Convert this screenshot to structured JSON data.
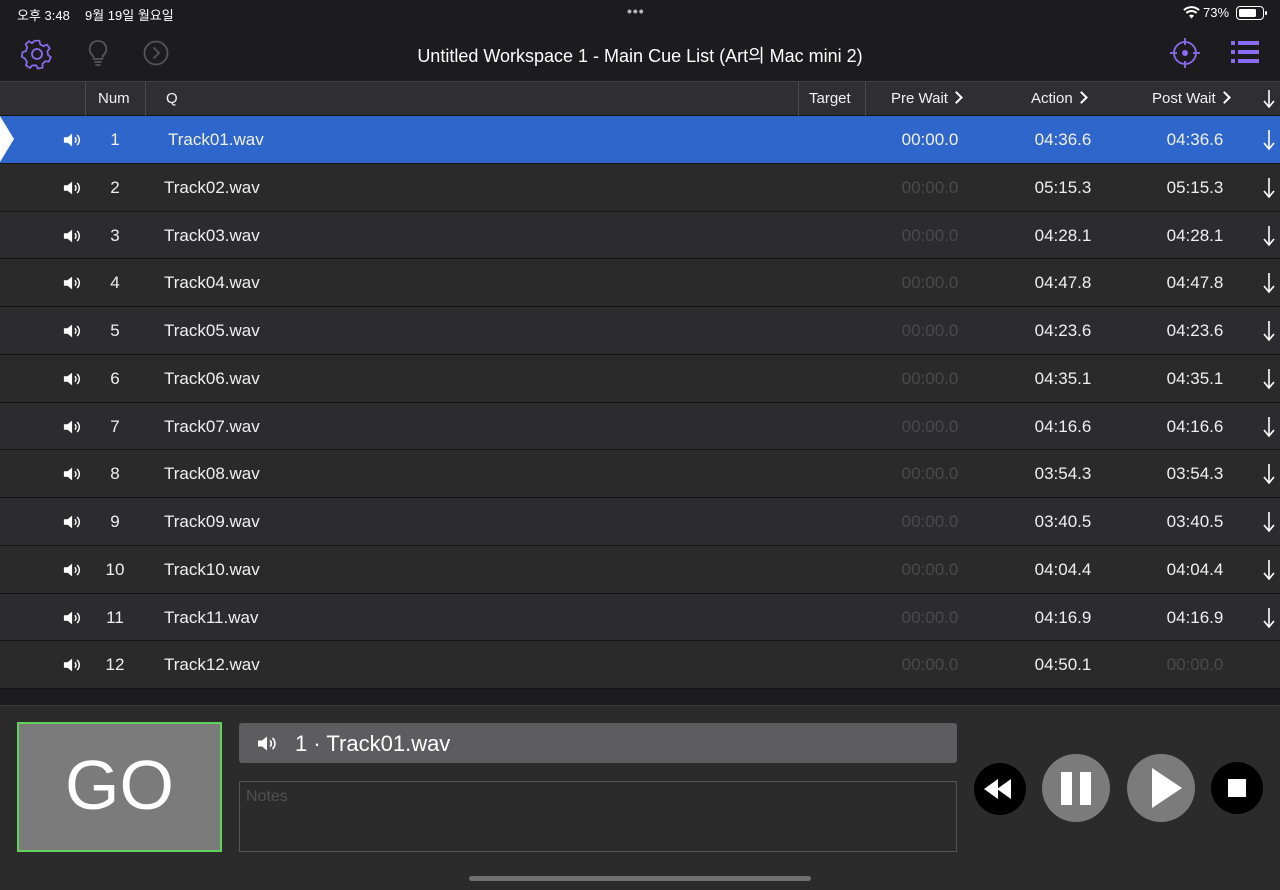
{
  "status": {
    "time": "오후 3:48",
    "date": "9월 19일 월요일",
    "dots": "•••",
    "battery_pct": "73%"
  },
  "toolbar": {
    "title": "Untitled Workspace 1 - Main Cue List (Art의 Mac mini 2)",
    "icons": [
      "gear-icon",
      "lightbulb-icon",
      "next-circle-icon",
      "target-icon",
      "list-icon"
    ],
    "accent_color": "#8b6cf0"
  },
  "columns": {
    "num": "Num",
    "q": "Q",
    "target": "Target",
    "pre_wait": "Pre Wait",
    "action": "Action",
    "post_wait": "Post Wait"
  },
  "cues": [
    {
      "num": "1",
      "name": "Track01.wav",
      "pre_wait": "00:00.0",
      "action": "04:36.6",
      "post_wait": "04:36.6"
    },
    {
      "num": "2",
      "name": "Track02.wav",
      "pre_wait": "00:00.0",
      "action": "05:15.3",
      "post_wait": "05:15.3"
    },
    {
      "num": "3",
      "name": "Track03.wav",
      "pre_wait": "00:00.0",
      "action": "04:28.1",
      "post_wait": "04:28.1"
    },
    {
      "num": "4",
      "name": "Track04.wav",
      "pre_wait": "00:00.0",
      "action": "04:47.8",
      "post_wait": "04:47.8"
    },
    {
      "num": "5",
      "name": "Track05.wav",
      "pre_wait": "00:00.0",
      "action": "04:23.6",
      "post_wait": "04:23.6"
    },
    {
      "num": "6",
      "name": "Track06.wav",
      "pre_wait": "00:00.0",
      "action": "04:35.1",
      "post_wait": "04:35.1"
    },
    {
      "num": "7",
      "name": "Track07.wav",
      "pre_wait": "00:00.0",
      "action": "04:16.6",
      "post_wait": "04:16.6"
    },
    {
      "num": "8",
      "name": "Track08.wav",
      "pre_wait": "00:00.0",
      "action": "03:54.3",
      "post_wait": "03:54.3"
    },
    {
      "num": "9",
      "name": "Track09.wav",
      "pre_wait": "00:00.0",
      "action": "03:40.5",
      "post_wait": "03:40.5"
    },
    {
      "num": "10",
      "name": "Track10.wav",
      "pre_wait": "00:00.0",
      "action": "04:04.4",
      "post_wait": "04:04.4"
    },
    {
      "num": "11",
      "name": "Track11.wav",
      "pre_wait": "00:00.0",
      "action": "04:16.9",
      "post_wait": "04:16.9"
    },
    {
      "num": "12",
      "name": "Track12.wav",
      "pre_wait": "00:00.0",
      "action": "04:50.1",
      "post_wait": "00:00.0"
    }
  ],
  "selected_index": 0,
  "auto_continue_count": 11,
  "selection_color": "#2f66cc",
  "go": {
    "label": "GO",
    "border_color": "#5fd35a"
  },
  "current_cue": {
    "num": "1",
    "sep": "·",
    "name": "Track01.wav"
  },
  "notes": {
    "placeholder": "Notes"
  },
  "transport": [
    "rewind-icon",
    "pause-icon",
    "play-icon",
    "stop-icon"
  ]
}
